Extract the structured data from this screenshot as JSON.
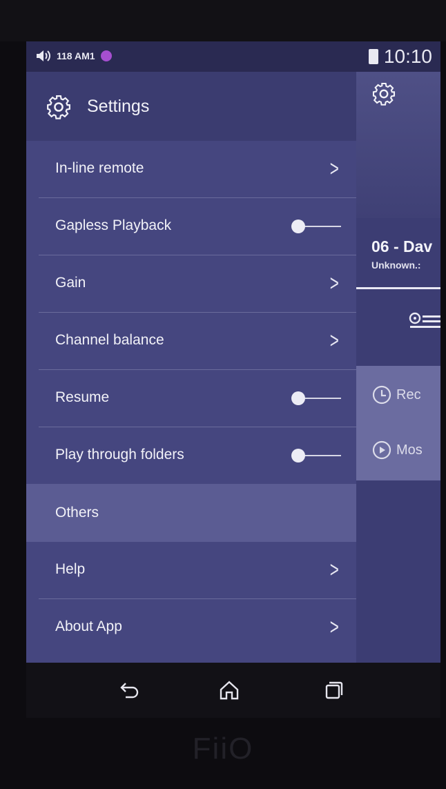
{
  "status_bar": {
    "left_text": "118 AM1",
    "time": "10:10",
    "icons": [
      "volume-icon",
      "notification-badge-icon",
      "battery-icon"
    ]
  },
  "drawer": {
    "title": "Settings",
    "title_icon": "gear-icon",
    "items": [
      {
        "label": "In-line remote",
        "control": "chevron"
      },
      {
        "label": "Gapless Playback",
        "control": "toggle",
        "state": "off"
      },
      {
        "label": "Gain",
        "control": "chevron"
      },
      {
        "label": "Channel balance",
        "control": "chevron"
      },
      {
        "label": "Resume",
        "control": "toggle",
        "state": "off"
      },
      {
        "label": "Play through folders",
        "control": "toggle",
        "state": "off"
      }
    ],
    "section_label": "Others",
    "other_items": [
      {
        "label": "Help",
        "control": "chevron"
      },
      {
        "label": "About App",
        "control": "chevron"
      }
    ]
  },
  "peek_panel": {
    "track_title": "06 - Dav",
    "track_subtitle": "Unknown.:",
    "menu": [
      {
        "label": "Rec",
        "icon": "clock-icon"
      },
      {
        "label": "Mos",
        "icon": "play-circle-icon"
      }
    ]
  },
  "navbar": {
    "buttons": [
      "back-icon",
      "home-icon",
      "recents-icon"
    ]
  },
  "brand": "FiiO",
  "colors": {
    "panel": "#45467f",
    "section": "#5b5c93",
    "text": "#f2f2f8"
  }
}
